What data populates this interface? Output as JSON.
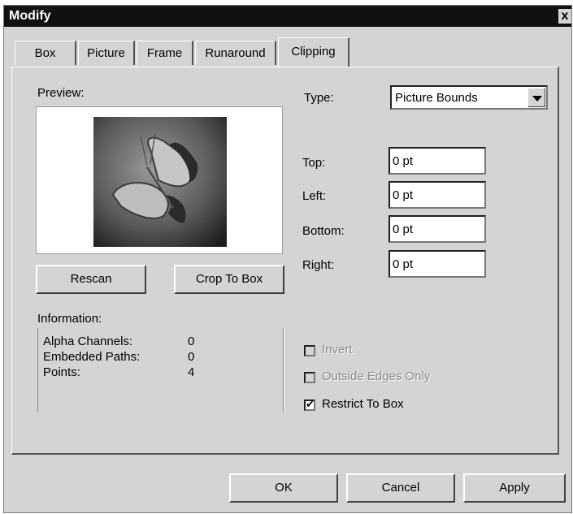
{
  "window": {
    "title": "Modify",
    "close_label": "x"
  },
  "tabs": [
    {
      "label": "Box",
      "active": false
    },
    {
      "label": "Picture",
      "active": false
    },
    {
      "label": "Frame",
      "active": false
    },
    {
      "label": "Runaround",
      "active": false
    },
    {
      "label": "Clipping",
      "active": true
    }
  ],
  "preview": {
    "label": "Preview:",
    "image": "butterfly-photo"
  },
  "buttons": {
    "rescan": "Rescan",
    "crop_to_box": "Crop To Box"
  },
  "information": {
    "label": "Information:",
    "rows": [
      {
        "label": "Alpha Channels:",
        "value": "0"
      },
      {
        "label": "Embedded Paths:",
        "value": "0"
      },
      {
        "label": "Points:",
        "value": "4"
      }
    ]
  },
  "type": {
    "label": "Type:",
    "value": "Picture Bounds"
  },
  "offsets": {
    "top": {
      "label": "Top:",
      "value": "0 pt"
    },
    "left": {
      "label": "Left:",
      "value": "0 pt"
    },
    "bottom": {
      "label": "Bottom:",
      "value": "0 pt"
    },
    "right": {
      "label": "Right:",
      "value": "0 pt"
    }
  },
  "options": {
    "invert": {
      "label": "Invert",
      "checked": false,
      "enabled": false
    },
    "outside_edges_only": {
      "label": "Outside Edges Only",
      "checked": false,
      "enabled": false
    },
    "restrict_to_box": {
      "label": "Restrict To Box",
      "checked": true,
      "enabled": true
    }
  },
  "footer": {
    "ok": "OK",
    "cancel": "Cancel",
    "apply": "Apply"
  }
}
